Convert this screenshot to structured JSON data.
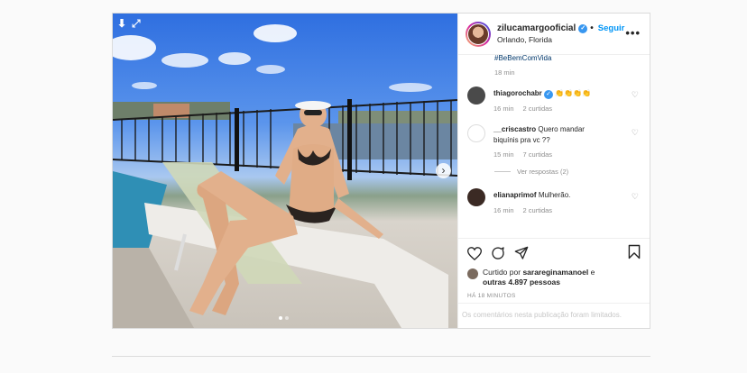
{
  "post": {
    "username": "zilucamargooficial",
    "verified": true,
    "follow_label": "Seguir",
    "location": "Orlando, Florida",
    "more_icon": "more-horizontal-icon",
    "carousel": {
      "current": 1,
      "total": 2
    }
  },
  "comments": {
    "cut_text": "#BeBemComVida",
    "cut_time": "18 min",
    "items": [
      {
        "user": "thiagorochabr",
        "verified": true,
        "text": "👏👏👏👏",
        "time": "16 min",
        "likes": "2 curtidas",
        "avatar_color": "#4a4a4a"
      },
      {
        "user": "__criscastro",
        "verified": false,
        "text": "Quero mandar biquínis pra vc ??",
        "time": "15 min",
        "likes": "7 curtidas",
        "replies": "Ver respostas (2)",
        "avatar_color": "#ffffff"
      },
      {
        "user": "elianaprimof",
        "verified": false,
        "text": "Mulherão.",
        "time": "16 min",
        "likes": "2 curtidas",
        "avatar_color": "#3b2a24"
      }
    ]
  },
  "actions": {
    "icons": [
      "heart-icon",
      "comment-icon",
      "share-icon",
      "bookmark-icon"
    ],
    "likes_prefix": "Curtido por",
    "likes_user": "sarareginamanoel",
    "likes_connector": "e",
    "likes_others": "outras 4.897 pessoas",
    "time_ago": "HÁ 18 MINUTOS",
    "limited_comments": "Os comentários nesta publicação foram limitados."
  },
  "colors": {
    "link_blue": "#0095f6",
    "verified_blue": "#3897f0",
    "muted": "#8e8e8e"
  }
}
